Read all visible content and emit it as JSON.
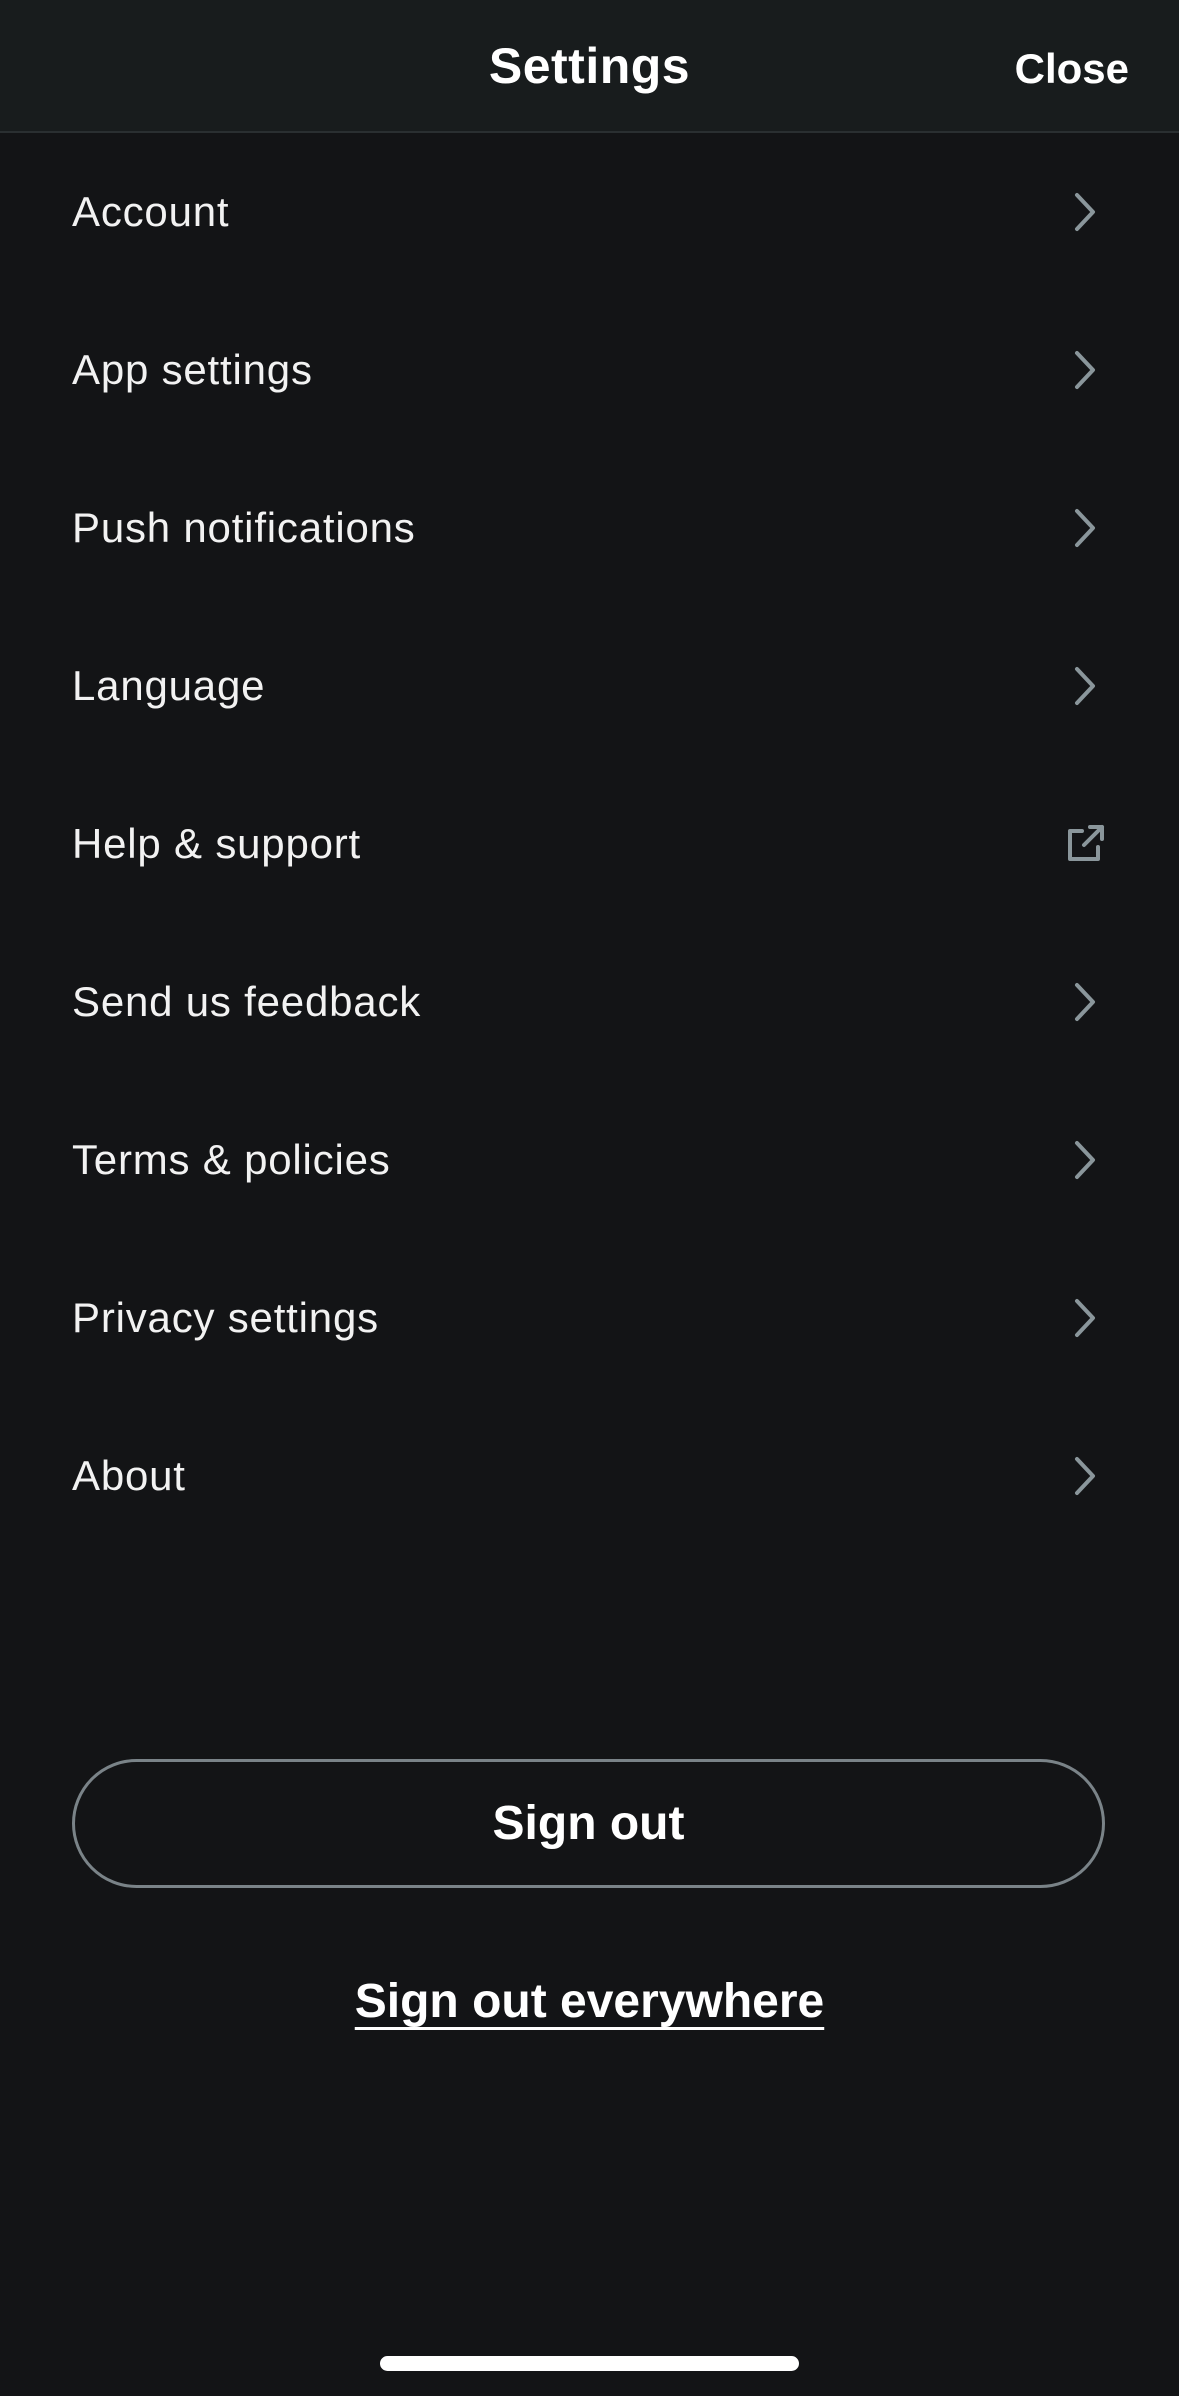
{
  "header": {
    "title": "Settings",
    "close_label": "Close"
  },
  "menu": {
    "items": [
      {
        "label": "Account",
        "icon": "chevron-right-icon"
      },
      {
        "label": "App settings",
        "icon": "chevron-right-icon"
      },
      {
        "label": "Push notifications",
        "icon": "chevron-right-icon"
      },
      {
        "label": "Language",
        "icon": "chevron-right-icon"
      },
      {
        "label": "Help & support",
        "icon": "external-link-icon"
      },
      {
        "label": "Send us feedback",
        "icon": "chevron-right-icon"
      },
      {
        "label": "Terms & policies",
        "icon": "chevron-right-icon"
      },
      {
        "label": "Privacy settings",
        "icon": "chevron-right-icon"
      },
      {
        "label": "About",
        "icon": "chevron-right-icon"
      }
    ]
  },
  "actions": {
    "sign_out_label": "Sign out",
    "sign_out_everywhere_label": "Sign out everywhere"
  },
  "colors": {
    "background": "#131416",
    "header_background": "#181c1d",
    "icon": "#8a969b",
    "button_border": "#7a8388"
  }
}
